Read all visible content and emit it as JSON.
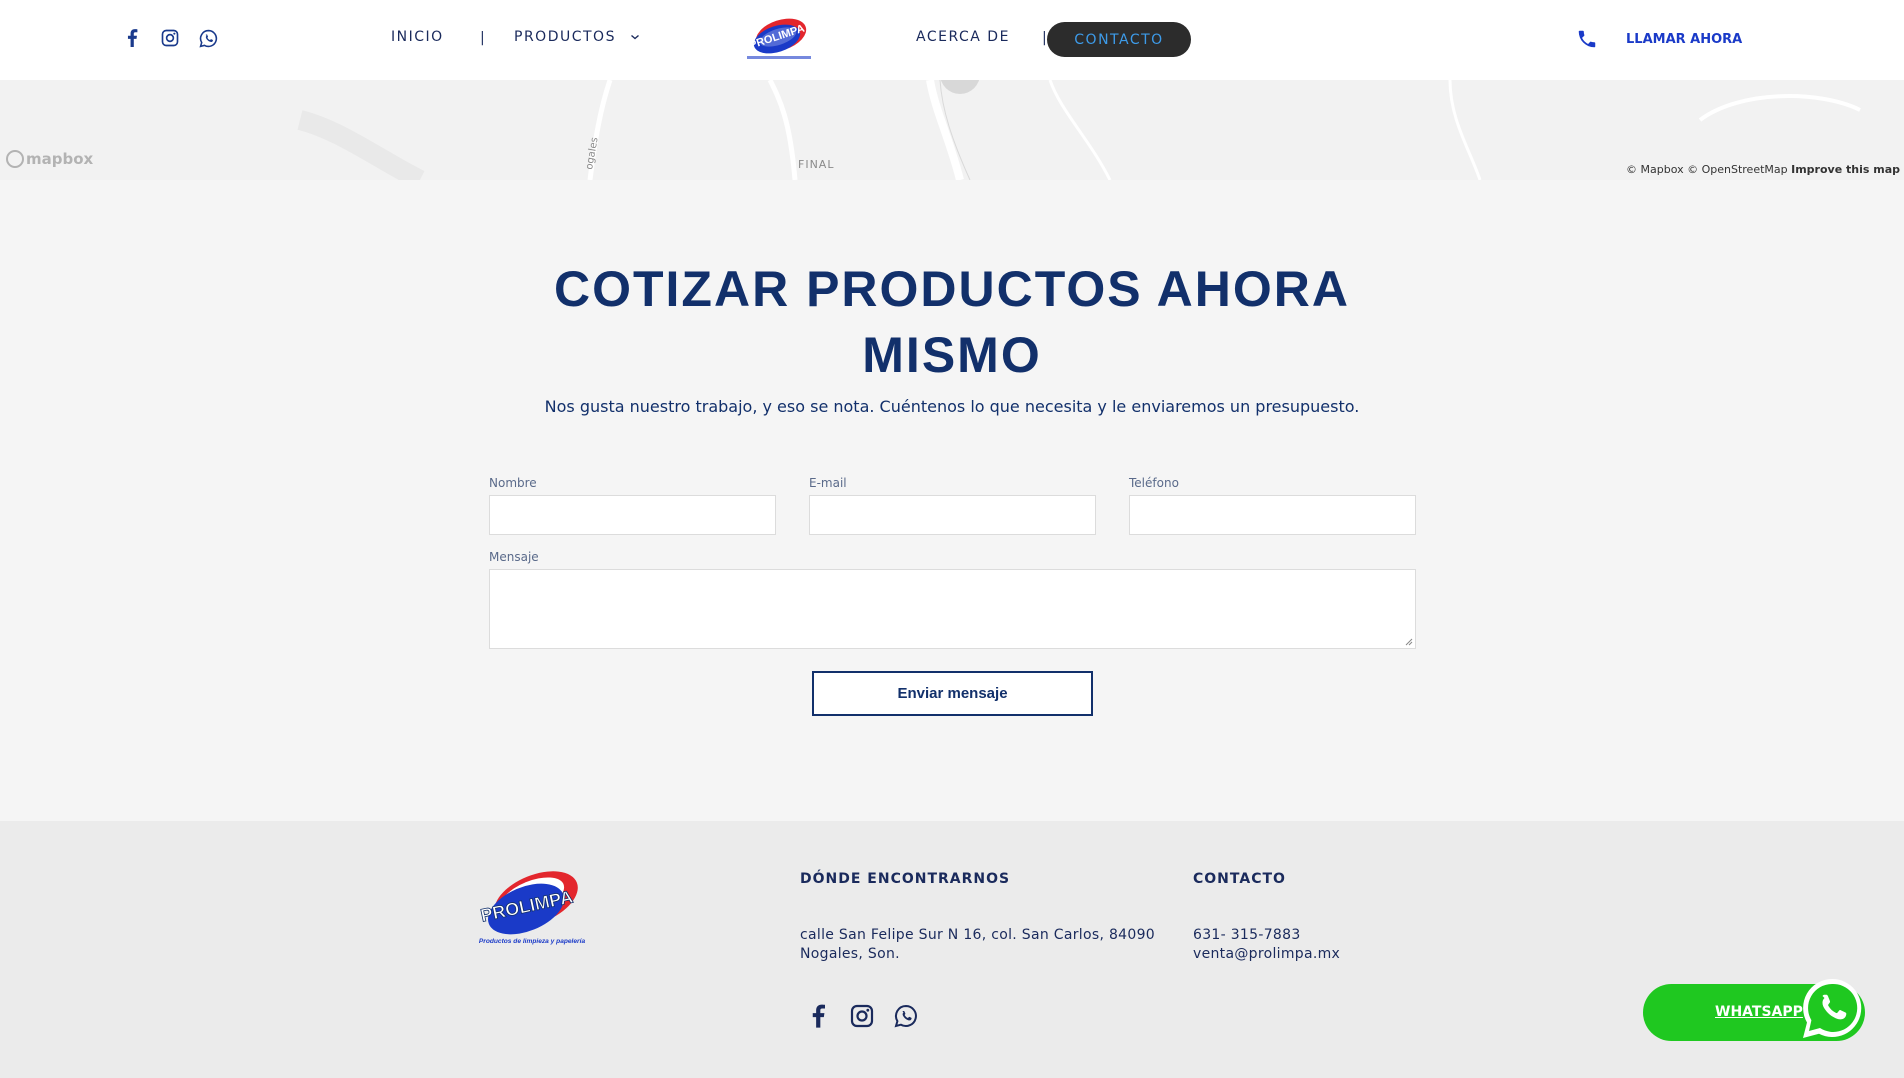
{
  "header": {
    "social": [
      {
        "icon": "facebook-icon"
      },
      {
        "icon": "instagram-icon"
      },
      {
        "icon": "whatsapp-icon"
      }
    ],
    "nav": {
      "inicio": "INICIO",
      "productos": "PRODUCTOS",
      "acerca": "ACERCA DE",
      "contacto": "CONTACTO",
      "separator": "|"
    },
    "call_now": "LLAMAR AHORA"
  },
  "map": {
    "label_final": "FINAL",
    "street_label": "ogales",
    "mapbox": "mapbox",
    "attribution": "© Mapbox © OpenStreetMap",
    "improve": "Improve this map"
  },
  "quote": {
    "title_line1": "COTIZAR PRODUCTOS AHORA",
    "title_line2": "MISMO",
    "subtitle": "Nos gusta nuestro trabajo, y eso se nota. Cuéntenos lo que necesita y le enviaremos un presupuesto.",
    "fields": {
      "nombre": "Nombre",
      "email": "E-mail",
      "telefono": "Teléfono",
      "mensaje": "Mensaje"
    },
    "submit": "Enviar mensaje"
  },
  "footer": {
    "where_title": "DÓNDE ENCONTRARNOS",
    "address_line1": "calle San Felipe Sur N 16, col. San Carlos, 84090",
    "address_line2": "Nogales, Son.",
    "contact_title": "CONTACTO",
    "phone": "631- 315-7883",
    "email": "venta@prolimpa.mx"
  },
  "logo": {
    "brand": "PROLIMPA",
    "tagline": "Productos de limpieza y papelería"
  },
  "whatsapp_button": "WHATSAPP",
  "colors": {
    "primary": "#12306b",
    "accent_blue": "#1a3ac8",
    "whatsapp_green": "#1fc820",
    "contact_btn_bg": "#2c2c2c",
    "contact_btn_text": "#3d9be9"
  }
}
